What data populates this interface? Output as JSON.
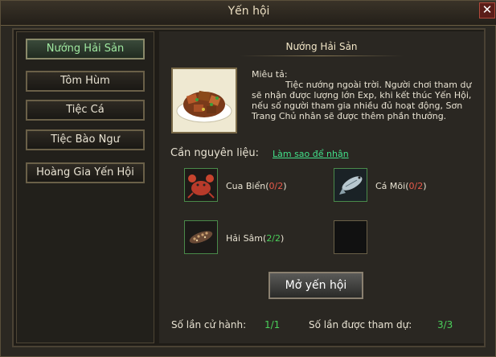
{
  "window": {
    "title": "Yến hội",
    "close_glyph": "✕"
  },
  "menu": {
    "items": [
      {
        "label": "Nướng Hải Sản",
        "active": true
      },
      {
        "label": "Tôm Hùm",
        "active": false
      },
      {
        "label": "Tiệc Cá",
        "active": false
      },
      {
        "label": "Tiệc Bào Ngư",
        "active": false
      },
      {
        "label": "Hoàng Gia Yến Hội",
        "active": false
      }
    ]
  },
  "detail": {
    "title": "Nướng Hải Sản",
    "image_icon": "grilled-seafood-dish-icon",
    "desc_label": "Miêu tả:",
    "desc_text": "Tiệc nướng ngoài trời. Người chơi tham dự sẽ nhận được lượng lớn Exp, khi kết thúc Yến Hội, nếu số người tham gia nhiều đủ hoạt động, Sơn Trang Chủ nhân sẽ được thêm phần thưởng.",
    "req_label": "Cần nguyên liệu:",
    "req_link": "Làm sao để nhận"
  },
  "ingredients": [
    {
      "name": "Cua Biển",
      "count": "0/2",
      "icon": "crab-icon"
    },
    {
      "name": "Cá Mõi",
      "count": "0/2",
      "icon": "fish-icon"
    },
    {
      "name": "Hải Sâm",
      "count": "2/2",
      "icon": "sea-cucumber-icon"
    },
    {
      "name": "",
      "count": "",
      "icon": "empty-slot"
    }
  ],
  "actions": {
    "open_label": "Mở yến hội"
  },
  "stats": {
    "hold_label": "Số lần cử hành:",
    "hold_value": "1/1",
    "join_label": "Số lần được tham dự:",
    "join_value": "3/3"
  },
  "colors": {
    "accent_green": "#4ad05a",
    "count_red": "#e85a4a",
    "link_green": "#42e08a"
  }
}
